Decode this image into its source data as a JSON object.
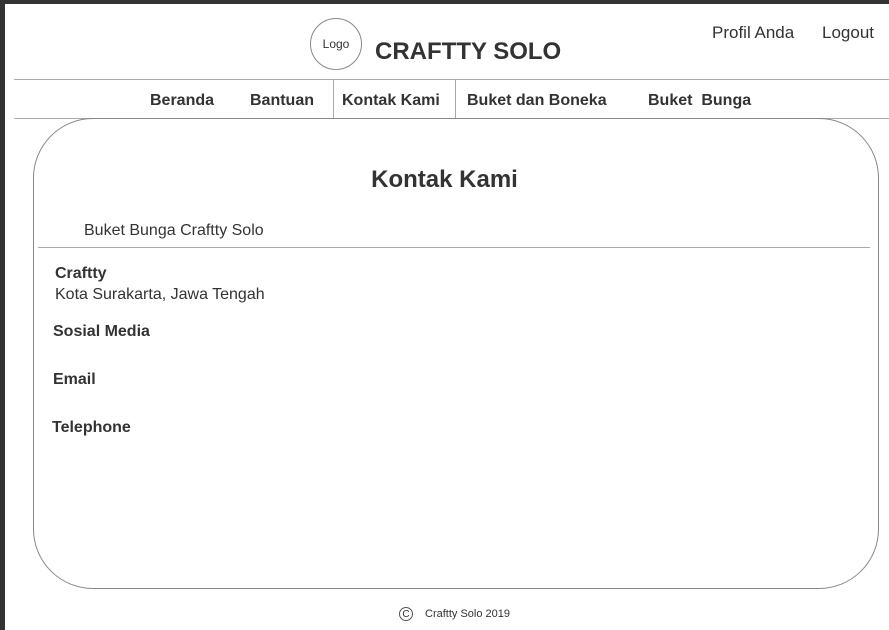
{
  "header": {
    "logo_text": "Logo",
    "site_title": "CRAFTTY SOLO",
    "profile_link": "Profil Anda",
    "logout_link": "Logout"
  },
  "nav": {
    "items": [
      {
        "label": "Beranda"
      },
      {
        "label": "Bantuan"
      },
      {
        "label": "Kontak Kami",
        "active": true
      },
      {
        "label": "Buket dan Boneka"
      },
      {
        "label": "Buket  Bunga"
      }
    ]
  },
  "main": {
    "title": "Kontak Kami",
    "subtitle": "Buket Bunga Craftty Solo",
    "company_name": "Craftty",
    "address": "Kota Surakarta, Jawa Tengah",
    "social_label": "Sosial Media",
    "email_label": "Email",
    "telephone_label": "Telephone"
  },
  "footer": {
    "copyright_symbol": "C",
    "text": "Craftty Solo 2019"
  },
  "colors": {
    "text": "#333333",
    "border": "#888888",
    "divider": "#aaaaaa"
  }
}
